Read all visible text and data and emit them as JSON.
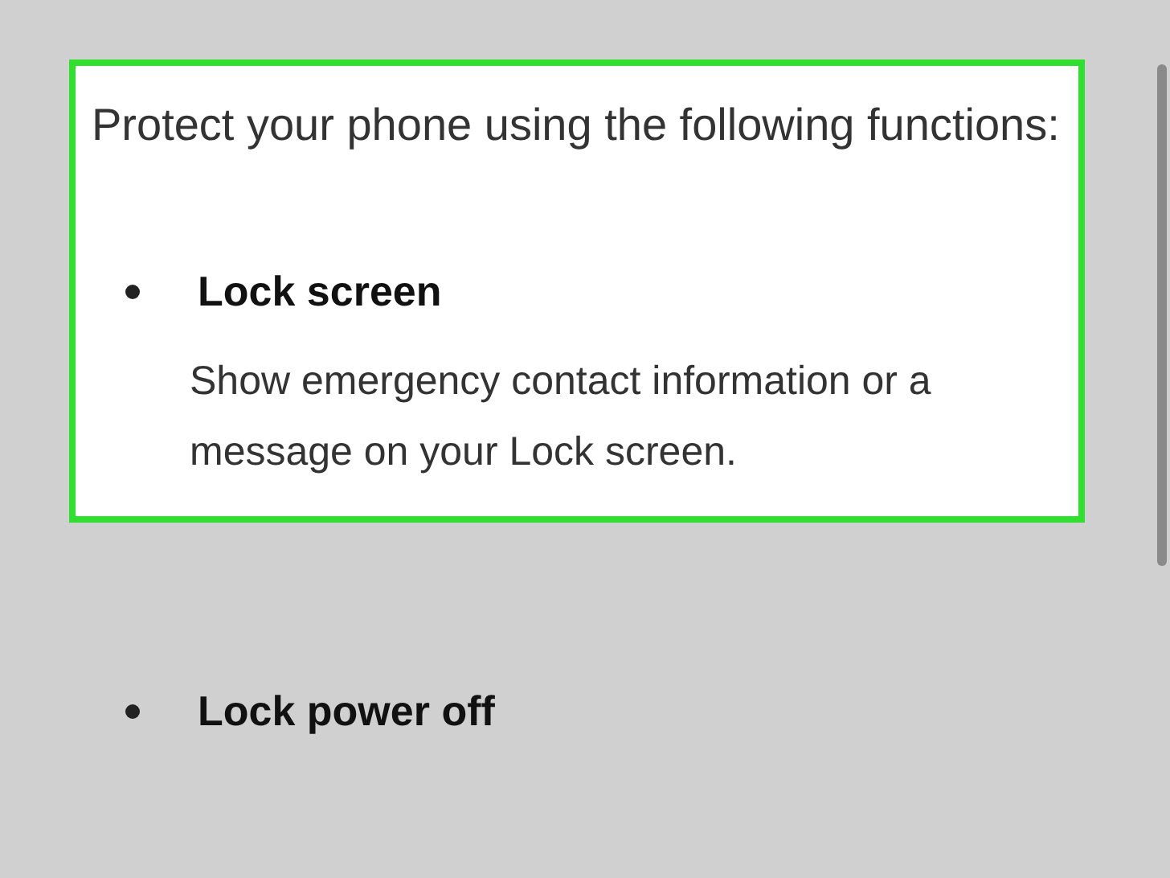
{
  "panel": {
    "intro": "Protect your phone using the following functions:",
    "items": [
      {
        "title": "Lock screen",
        "description": "Show emergency contact information or a message on your Lock screen."
      }
    ]
  },
  "items": [
    {
      "title": "Lock power off"
    }
  ]
}
